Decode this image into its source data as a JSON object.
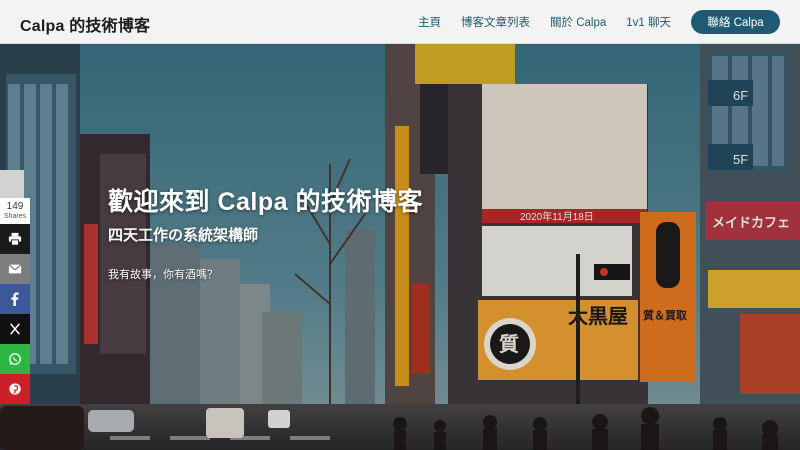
{
  "header": {
    "brand": "Calpa 的技術博客",
    "nav": [
      {
        "label": "主頁"
      },
      {
        "label": "博客文章列表"
      },
      {
        "label": "關於 Calpa"
      },
      {
        "label": "1v1 聊天"
      }
    ],
    "cta_label": "聯絡 Calpa"
  },
  "hero": {
    "title": "歡迎來到 Calpa 的技術博客",
    "subtitle": "四天工作の系統架構師",
    "tagline": "我有故事，你有酒嗎？",
    "signs": {
      "kuro": "大黒屋",
      "shichi": "質",
      "buy": "質＆買取",
      "maid": "メイドカフェ",
      "anime": "2020年11月18日",
      "floor6": "6F",
      "floor5": "5F"
    }
  },
  "share": {
    "count": "149",
    "count_label": "Shares",
    "buttons": [
      {
        "icon": "print-icon",
        "color": "#1a1a1a"
      },
      {
        "icon": "email-icon",
        "color": "#7d7d7d"
      },
      {
        "icon": "facebook-icon",
        "color": "#3b5998"
      },
      {
        "icon": "x-twitter-icon",
        "color": "#111111"
      },
      {
        "icon": "whatsapp-icon",
        "color": "#2db742"
      },
      {
        "icon": "pinterest-icon",
        "color": "#cb2027"
      }
    ]
  }
}
